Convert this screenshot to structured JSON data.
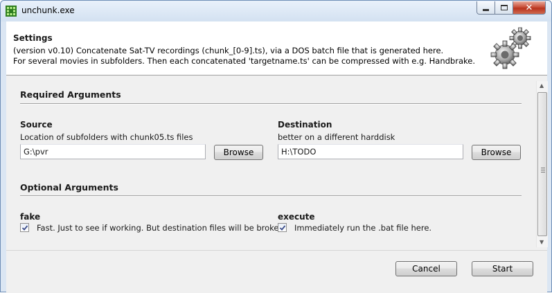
{
  "window": {
    "title": "unchunk.exe",
    "controls": {
      "minimize": "▬",
      "maximize": "□",
      "close": "✕"
    }
  },
  "header": {
    "title": "Settings",
    "line1": "(version v0.10) Concatenate Sat-TV recordings (chunk_[0-9].ts), via a DOS batch file that is generated here.",
    "line2": "For several movies in subfolders. Then each concatenated 'targetname.ts' can be compressed with e.g. Handbrake.",
    "icon": "gears-icon"
  },
  "required": {
    "title": "Required Arguments",
    "source": {
      "label": "Source",
      "description": "Location of subfolders with chunk05.ts files",
      "value": "G:\\pvr",
      "browse_label": "Browse"
    },
    "destination": {
      "label": "Destination",
      "description": "better on a different harddisk",
      "value": "H:\\TODO",
      "browse_label": "Browse"
    }
  },
  "optional": {
    "title": "Optional Arguments",
    "fake": {
      "label": "fake",
      "checked": true,
      "description": "Fast. Just to see if working. But destination files will be broken."
    },
    "execute": {
      "label": "execute",
      "checked": true,
      "description": "Immediately run the .bat file here."
    }
  },
  "footer": {
    "cancel_label": "Cancel",
    "start_label": "Start"
  },
  "colors": {
    "titlebar": "#d3e1f1",
    "close_button": "#c9503c",
    "client_bg": "#f0f0f0",
    "checkmark": "#3c4d8a"
  }
}
